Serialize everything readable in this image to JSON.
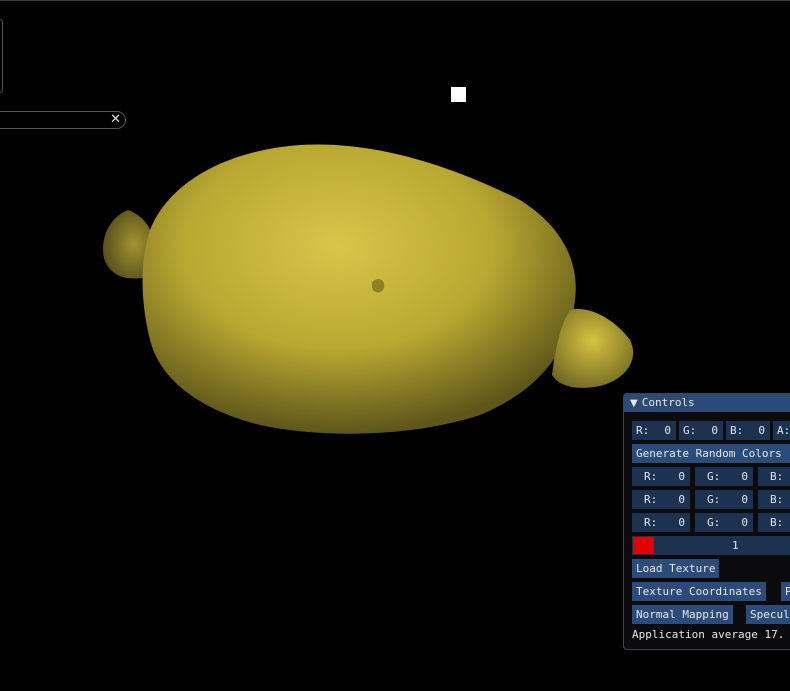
{
  "window": {
    "close_glyph": "✕"
  },
  "controls": {
    "title": "Controls",
    "collapse_glyph": "▼",
    "color_row": [
      {
        "label": "R:",
        "value": "0"
      },
      {
        "label": "G:",
        "value": "0"
      },
      {
        "label": "B:",
        "value": "0"
      },
      {
        "label": "A:",
        "value": ""
      }
    ],
    "generate_label": "Generate Random Colors",
    "rgb_rows": [
      [
        {
          "label": "R:",
          "value": "0"
        },
        {
          "label": "G:",
          "value": "0"
        },
        {
          "label": "B:",
          "value": ""
        }
      ],
      [
        {
          "label": "R:",
          "value": "0"
        },
        {
          "label": "G:",
          "value": "0"
        },
        {
          "label": "B:",
          "value": ""
        }
      ],
      [
        {
          "label": "R:",
          "value": "0"
        },
        {
          "label": "G:",
          "value": "0"
        },
        {
          "label": "B:",
          "value": ""
        }
      ]
    ],
    "slider_value": "1",
    "swatch_color": "#e00000",
    "load_texture_label": "Load Texture",
    "texture_coords_label": "Texture Coordinates",
    "p_label": "P",
    "normal_mapping_label": "Normal Mapping",
    "specular_label": "Specul",
    "status_text": "Application average 17."
  },
  "colors": {
    "background": "#000000",
    "panel_title": "#2b4a75",
    "button": "#2b4c7a",
    "field": "#1d3150",
    "lemon": "#c9b83a"
  }
}
